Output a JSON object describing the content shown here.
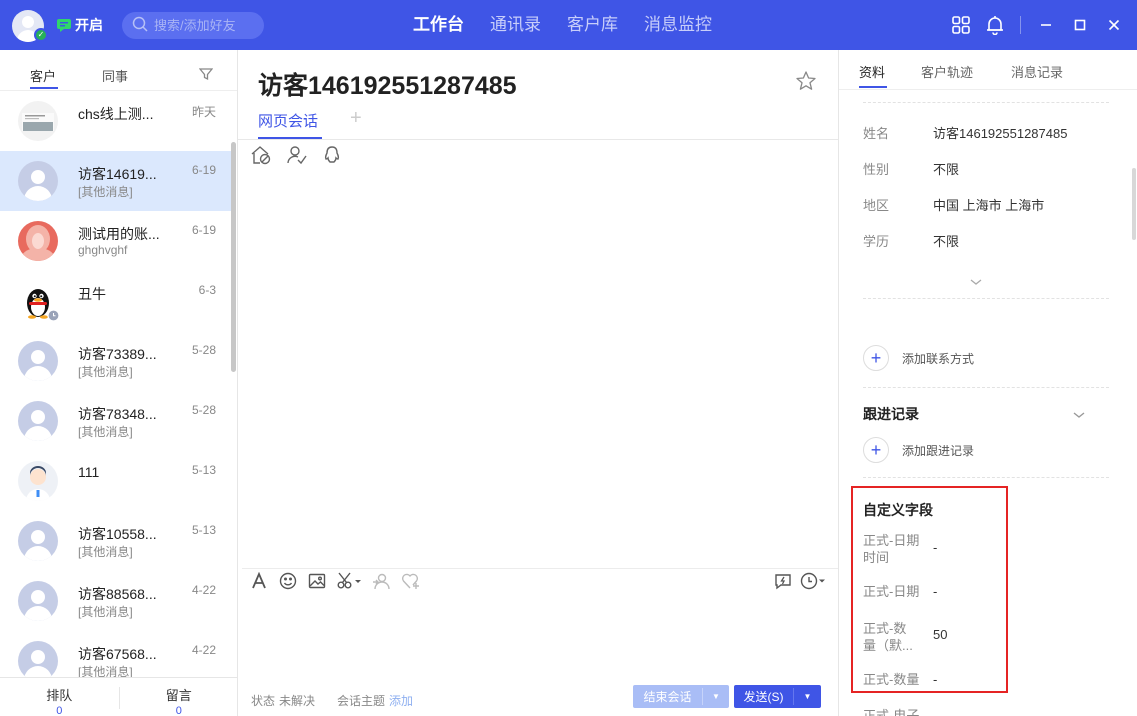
{
  "top": {
    "status_label": "开启",
    "search_placeholder": "搜索/添加好友",
    "nav": [
      "工作台",
      "通讯录",
      "客户库",
      "消息监控"
    ]
  },
  "left": {
    "tabs": [
      "客户",
      "同事"
    ],
    "conversations": [
      {
        "name": "chs线上测...",
        "sub": "",
        "date": "昨天"
      },
      {
        "name": "访客14619...",
        "sub": "[其他消息]",
        "date": "6-19"
      },
      {
        "name": "测试用的账...",
        "sub": "ghghvghf",
        "date": "6-19"
      },
      {
        "name": "丑牛",
        "sub": "",
        "date": "6-3"
      },
      {
        "name": "访客73389...",
        "sub": "[其他消息]",
        "date": "5-28"
      },
      {
        "name": "访客78348...",
        "sub": "[其他消息]",
        "date": "5-28"
      },
      {
        "name": "111",
        "sub": "",
        "date": "5-13"
      },
      {
        "name": "访客10558...",
        "sub": "[其他消息]",
        "date": "5-13"
      },
      {
        "name": "访客88568...",
        "sub": "[其他消息]",
        "date": "4-22"
      },
      {
        "name": "访客67568...",
        "sub": "[其他消息]",
        "date": "4-22"
      }
    ],
    "bottom": {
      "queue_label": "排队",
      "queue_count": "0",
      "msg_label": "留言",
      "msg_count": "0"
    }
  },
  "middle": {
    "title": "访客146192551287485",
    "session_tab": "网页会话",
    "add_tab": "+",
    "status_label": "状态",
    "status_value": "未解决",
    "topic_label": "会话主题",
    "topic_add": "添加",
    "end_button": "结束会话",
    "send_button": "发送(S)"
  },
  "right": {
    "tabs": [
      "资料",
      "客户轨迹",
      "消息记录"
    ],
    "profile": [
      {
        "key": "姓名",
        "value": "访客146192551287485"
      },
      {
        "key": "性别",
        "value": "不限"
      },
      {
        "key": "地区",
        "value": "中国 上海市 上海市"
      },
      {
        "key": "学历",
        "value": "不限"
      }
    ],
    "add_contact": "添加联系方式",
    "follow_title": "跟进记录",
    "add_follow": "添加跟进记录",
    "custom_title": "自定义字段",
    "custom_fields": [
      {
        "key_line1": "正式-日期",
        "key_line2": "时间",
        "value": "-"
      },
      {
        "key_line1": "正式-日期",
        "key_line2": "",
        "value": "-"
      },
      {
        "key_line1": "正式-数",
        "key_line2": "量（默...",
        "value": "50"
      },
      {
        "key_line1": "正式-数量",
        "key_line2": "",
        "value": "-"
      },
      {
        "key_line1": "正式-电子",
        "key_line2": "",
        "value": ""
      }
    ]
  }
}
